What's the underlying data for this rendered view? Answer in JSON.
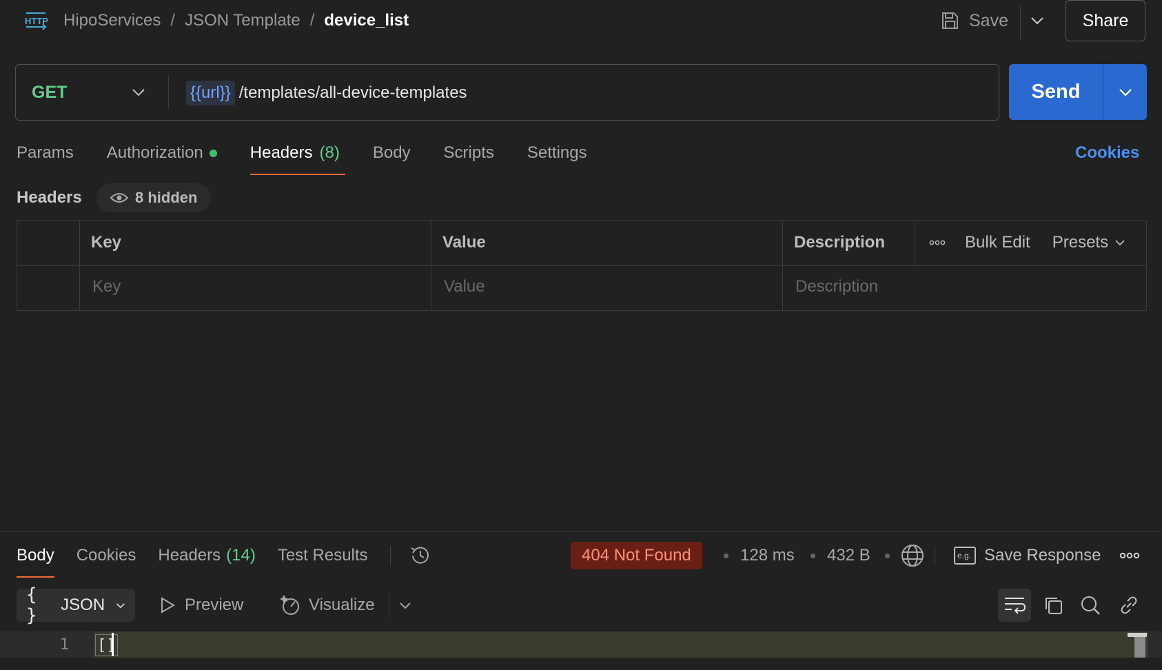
{
  "breadcrumb": {
    "icon": "http-icon",
    "items": [
      "HipoServices",
      "JSON Template"
    ],
    "separator": "/",
    "current": "device_list"
  },
  "header": {
    "save_label": "Save",
    "share_label": "Share"
  },
  "request": {
    "method": "GET",
    "url_variable": "{{url}}",
    "url_path": "/templates/all-device-templates",
    "send_label": "Send"
  },
  "request_tabs": {
    "params": "Params",
    "authorization": "Authorization",
    "headers": "Headers",
    "headers_count": "(8)",
    "body": "Body",
    "scripts": "Scripts",
    "settings": "Settings",
    "active": "Headers",
    "cookies_link": "Cookies"
  },
  "headers_section": {
    "title": "Headers",
    "hidden_label": "8 hidden",
    "columns": {
      "key": "Key",
      "value": "Value",
      "description": "Description"
    },
    "bulk_edit": "Bulk Edit",
    "presets": "Presets",
    "placeholders": {
      "key": "Key",
      "value": "Value",
      "description": "Description"
    }
  },
  "response": {
    "tabs": {
      "body": "Body",
      "cookies": "Cookies",
      "headers": "Headers",
      "headers_count": "(14)",
      "test_results": "Test Results",
      "active": "Body"
    },
    "status": "404 Not Found",
    "time": "128 ms",
    "size": "432 B",
    "save_response": "Save Response",
    "format": "JSON",
    "preview": "Preview",
    "visualize": "Visualize",
    "lines": [
      {
        "number": "1",
        "text": "[]"
      }
    ]
  },
  "colors": {
    "background": "#212121",
    "accent_blue": "#2a6ad0",
    "method_green": "#5fcf8c",
    "active_tab_underline": "#ef6c3a",
    "status_error_bg": "#6a1f14",
    "status_error_text": "#ff8f7a"
  }
}
